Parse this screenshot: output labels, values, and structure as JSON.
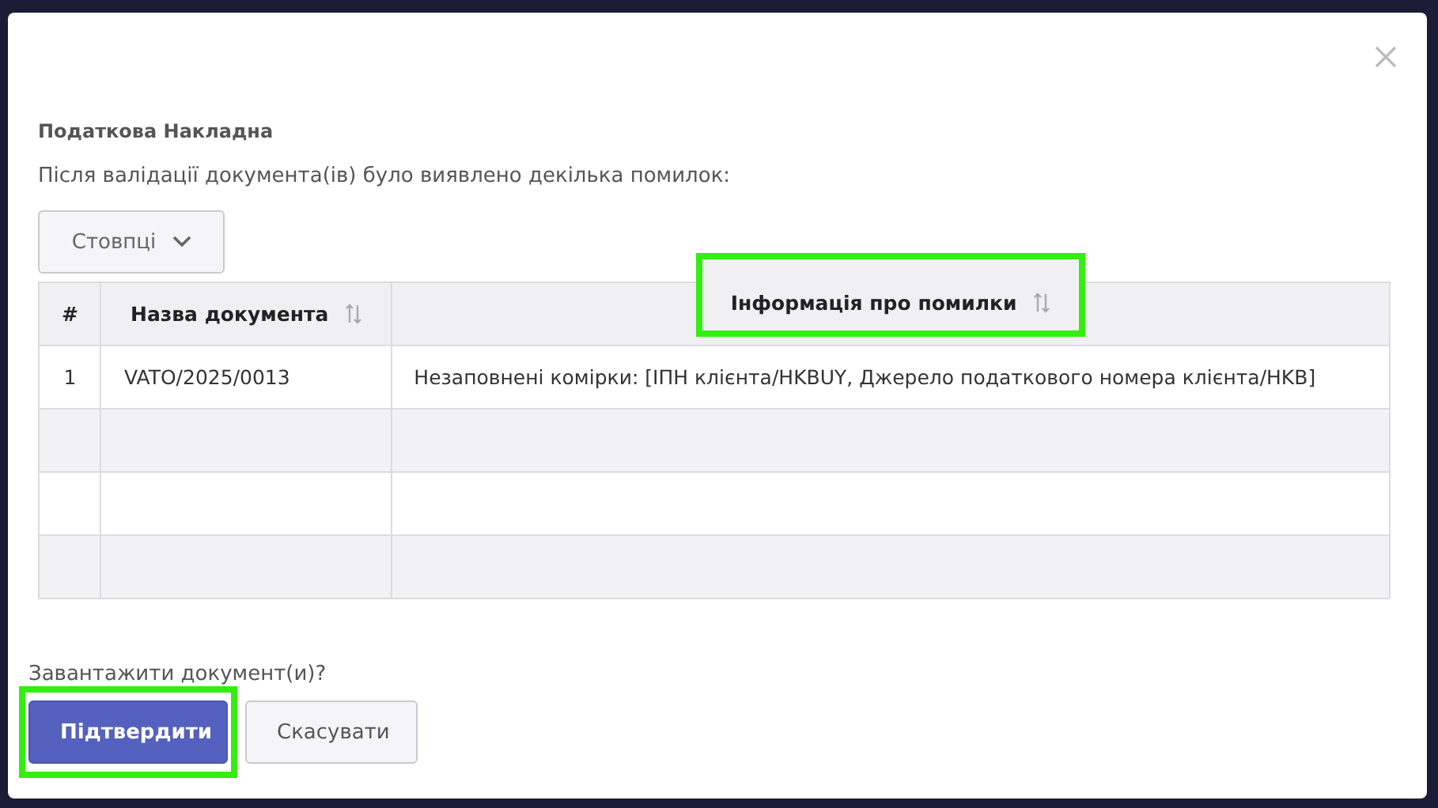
{
  "dialog": {
    "title": "Податкова Накладна",
    "message": "Після валідації документа(ів) було виявлено декілька помилок:"
  },
  "columns_button": {
    "label": "Стовпці"
  },
  "table": {
    "columns": [
      {
        "label": "#",
        "sortable": false,
        "highlighted": false
      },
      {
        "label": "Назва документа",
        "sortable": true,
        "highlighted": false
      },
      {
        "label": "Інформація про помилки",
        "sortable": true,
        "highlighted": true
      }
    ],
    "rows": [
      [
        "1",
        "VATO/2025/0013",
        "Незаповнені комірки: [ІПН клієнта/HKBUY, Джерело податкового номера клієнта/HKB]"
      ]
    ]
  },
  "prompt": "Завантажити документ(и)?",
  "buttons": [
    {
      "label": "Підтвердити",
      "kind": "primary",
      "highlighted": true
    },
    {
      "label": "Скасувати",
      "kind": "secondary",
      "highlighted": false
    }
  ]
}
